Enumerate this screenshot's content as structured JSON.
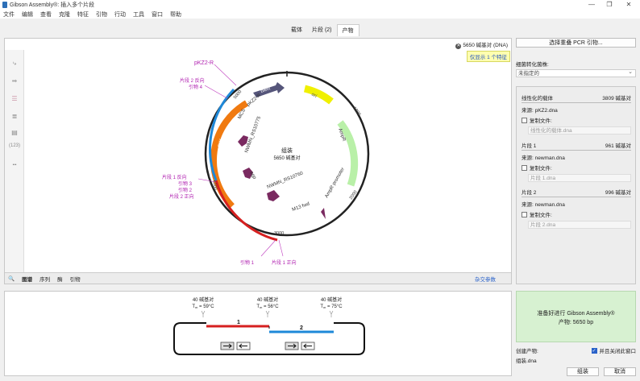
{
  "window": {
    "title": "Gibson Assembly®: 插入多个片段",
    "minimize": "—",
    "restore": "❐",
    "close": "✕"
  },
  "menu": [
    "文件",
    "编辑",
    "查看",
    "克隆",
    "特征",
    "引物",
    "行动",
    "工具",
    "窗口",
    "帮助"
  ],
  "tabs": [
    {
      "label": "载体",
      "active": false
    },
    {
      "label": "片段 (2)",
      "active": false
    },
    {
      "label": "产物",
      "active": true
    }
  ],
  "map": {
    "length_label": "5650 碱基对 (DNA)",
    "feature_notice": "仅显示 1 个特征",
    "center_title": "组装",
    "center_subtitle": "5650 碱基对",
    "ticks": [
      "1000",
      "2000",
      "3000",
      "4000",
      "5000"
    ],
    "features": [
      "bleR",
      "ori",
      "AmpR",
      "AmpR promoter",
      "M13 fwd",
      "NWMN_RS10760",
      "egp",
      "NWMN_RS10775",
      "MCS",
      "pKZ2-R",
      "DW",
      "UP"
    ],
    "labels": {
      "pkz2r": "pKZ2-R",
      "frag2_rev": "片段 2 反向",
      "primer4": "引物 4",
      "frag1_rev": "片段 1 反向",
      "primer3": "引物 3",
      "primer2": "引物 2",
      "frag2_fwd": "片段 2 正向",
      "primer1": "引物 1",
      "frag1_fwd": "片段 1 正向"
    },
    "left_counter": "(123)",
    "view_tabs": [
      "图谱",
      "序列",
      "酶",
      "引物"
    ],
    "params_link": "杂交参数"
  },
  "fragments_view": {
    "overlaps": [
      {
        "bp": "40 碱基对",
        "tm_label": "T",
        "tm_sub": "m",
        "tm_value": " = 59°C"
      },
      {
        "bp": "40 碱基对",
        "tm_label": "T",
        "tm_sub": "m",
        "tm_value": " = 56°C"
      },
      {
        "bp": "40 碱基对",
        "tm_label": "T",
        "tm_sub": "m",
        "tm_value": " = 75°C"
      }
    ],
    "fragment_numbers": [
      "1",
      "2"
    ]
  },
  "right": {
    "choose_primers_button": "选择重叠 PCR 引物...",
    "transform_label": "细菌转化菌株:",
    "transform_value": "未指定的",
    "vector": {
      "title": "线性化的载体",
      "length": "3809 碱基对",
      "source": "来源:  pKZ2.dna",
      "copy_label": "复制文件:",
      "copy_placeholder": "线性化的载体.dna"
    },
    "frag1": {
      "title": "片段 1",
      "length": "961 碱基对",
      "source": "来源:  newman.dna",
      "copy_label": "复制文件:",
      "copy_placeholder": "片段 1.dna"
    },
    "frag2": {
      "title": "片段 2",
      "length": "996 碱基对",
      "source": "来源:  newman.dna",
      "copy_label": "复制文件:",
      "copy_placeholder": "片段 2.dna"
    },
    "ready_line1": "准备好进行 Gibson Assembly®",
    "ready_line2": "产物:  5650 bp",
    "create_product_label": "创建产物:",
    "close_window_label": "并且关闭此窗口",
    "product_name": "组装.dna",
    "assemble_button": "组装",
    "cancel_button": "取消"
  },
  "colors": {
    "accent": "#2a62c9",
    "frag1": "#d62020",
    "frag2": "#1e88d8",
    "ready_bg": "#d7f1d1",
    "feature_purple": "#7a2a60",
    "ori": "#f0f000",
    "ampr": "#b9f0a8",
    "orange": "#f07a10"
  }
}
